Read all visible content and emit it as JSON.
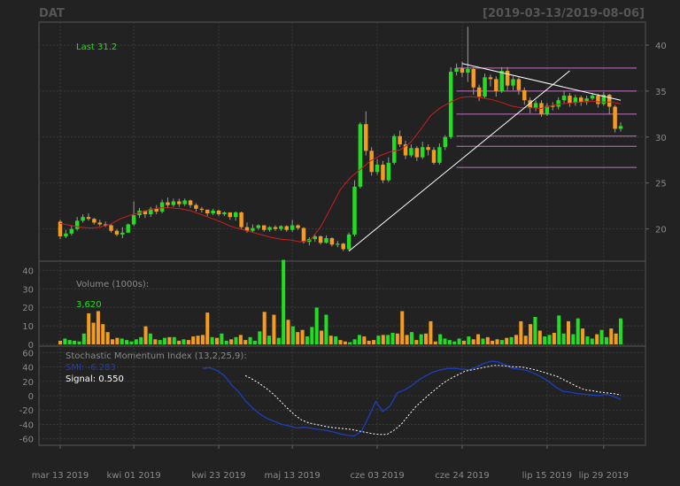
{
  "header": {
    "symbol": "DAT",
    "range": "[2019-03-13/2019-08-06]"
  },
  "labels": {
    "last": "Last 31.2",
    "volume_title": "Volume (1000s):",
    "volume_value": "3,620",
    "smi_title": "Stochastic Momentum Index (13,2,25,9):",
    "smi_value": "SMI: -6.283",
    "signal_value": "Signal: 0.550"
  },
  "colors": {
    "background": "#222222",
    "up": "#22dd22",
    "down": "#f39c1f",
    "label_green": "#22dd22",
    "smi_line": "#1a3fbf",
    "signal_line": "#ffffff",
    "ma_line": "#cc1f1f",
    "trend_line": "#ffffff",
    "support_lines": "#c670c6",
    "grid": "#3a3a3a",
    "axis_text": "#8a8a8a"
  },
  "chart_data": {
    "type": "candlestick",
    "title": "DAT",
    "subtitle": "[2019-03-13/2019-08-06]",
    "x_tick_labels": [
      "mar 13 2019",
      "kwi 01 2019",
      "kwi 23 2019",
      "maj 13 2019",
      "cze 03 2019",
      "cze 24 2019",
      "lip 15 2019",
      "lip 29 2019"
    ],
    "x_tick_positions": [
      0,
      13,
      28,
      41,
      56,
      71,
      86,
      96
    ],
    "price_axis": {
      "ticks": [
        20,
        25,
        30,
        35,
        40
      ],
      "ylim": [
        16.5,
        42.5
      ]
    },
    "volume_axis": {
      "ticks": [
        0,
        10,
        20,
        30,
        40
      ],
      "ylim": [
        0,
        44
      ]
    },
    "smi_axis": {
      "ticks": [
        -60,
        -40,
        -20,
        0,
        20,
        40,
        60
      ],
      "ylim": [
        -69,
        69
      ]
    },
    "candles": [
      [
        20.8,
        20.6,
        19.2,
        21.0,
        18.9
      ],
      [
        19.2,
        19.7,
        19.5,
        19.9,
        19.0
      ],
      [
        19.5,
        20.1,
        20.0,
        20.4,
        19.3
      ],
      [
        20.0,
        21.2,
        20.9,
        21.3,
        19.8
      ],
      [
        20.9,
        21.0,
        21.3,
        21.6,
        20.7
      ],
      [
        21.3,
        21.5,
        21.1,
        21.7,
        20.9
      ],
      [
        21.1,
        21.0,
        20.7,
        21.2,
        20.5
      ],
      [
        20.7,
        20.8,
        20.5,
        21.0,
        20.3
      ],
      [
        20.5,
        20.6,
        20.4,
        20.8,
        20.2
      ],
      [
        20.4,
        20.3,
        19.8,
        20.5,
        19.6
      ],
      [
        19.8,
        19.7,
        19.4,
        20.0,
        19.2
      ],
      [
        19.4,
        20.0,
        19.6,
        20.2,
        19.0
      ],
      [
        19.6,
        20.2,
        20.5,
        20.6,
        19.8
      ],
      [
        20.5,
        22.0,
        21.5,
        23.0,
        20.3
      ],
      [
        21.5,
        21.8,
        22.0,
        22.3,
        21.2
      ],
      [
        22.0,
        21.5,
        21.6,
        22.0,
        21.2
      ],
      [
        21.6,
        21.8,
        22.2,
        22.4,
        21.3
      ],
      [
        22.2,
        22.4,
        21.9,
        22.6,
        21.6
      ],
      [
        21.9,
        22.7,
        22.9,
        23.2,
        21.7
      ],
      [
        22.9,
        23.0,
        22.6,
        23.4,
        22.3
      ],
      [
        22.6,
        22.8,
        23.0,
        23.3,
        22.4
      ],
      [
        23.0,
        23.1,
        22.7,
        23.3,
        22.4
      ],
      [
        22.7,
        22.9,
        23.1,
        23.3,
        22.5
      ],
      [
        23.1,
        23.0,
        22.6,
        23.2,
        22.3
      ],
      [
        22.6,
        22.5,
        22.2,
        22.8,
        21.9
      ],
      [
        22.2,
        22.3,
        22.1,
        22.4,
        21.8
      ],
      [
        22.1,
        21.9,
        21.7,
        22.1,
        21.4
      ],
      [
        21.7,
        21.8,
        22.0,
        22.2,
        21.5
      ],
      [
        22.0,
        21.9,
        21.6,
        22.1,
        21.4
      ],
      [
        21.6,
        21.7,
        21.8,
        21.9,
        21.4
      ],
      [
        21.8,
        21.6,
        21.3,
        21.8,
        21.0
      ],
      [
        21.3,
        21.5,
        21.8,
        21.9,
        20.9
      ],
      [
        21.8,
        21.5,
        20.2,
        21.9,
        20.0
      ],
      [
        20.2,
        20.5,
        19.8,
        20.7,
        19.6
      ],
      [
        19.8,
        20.3,
        20.1,
        20.5,
        19.6
      ],
      [
        20.1,
        20.2,
        20.4,
        20.5,
        19.9
      ],
      [
        20.4,
        20.2,
        19.9,
        20.4,
        19.7
      ],
      [
        19.9,
        20.1,
        20.2,
        20.3,
        19.7
      ],
      [
        20.2,
        20.3,
        20.0,
        20.4,
        19.8
      ],
      [
        20.0,
        20.1,
        20.3,
        20.4,
        19.8
      ],
      [
        20.3,
        20.2,
        19.9,
        20.4,
        19.7
      ],
      [
        19.9,
        20.3,
        20.4,
        21.0,
        19.7
      ],
      [
        20.4,
        20.2,
        20.1,
        20.5,
        19.9
      ],
      [
        20.1,
        19.9,
        18.6,
        20.2,
        18.4
      ],
      [
        18.6,
        18.5,
        18.9,
        19.1,
        18.2
      ],
      [
        18.9,
        19.1,
        19.2,
        19.4,
        18.6
      ],
      [
        19.2,
        19.0,
        18.5,
        19.3,
        18.3
      ],
      [
        18.5,
        18.7,
        19.0,
        19.3,
        18.4
      ],
      [
        19.0,
        18.9,
        18.3,
        19.1,
        18.1
      ],
      [
        18.3,
        18.5,
        18.4,
        18.7,
        18.0
      ],
      [
        18.4,
        18.2,
        17.8,
        18.5,
        17.6
      ],
      [
        17.8,
        18.6,
        19.4,
        19.6,
        17.6
      ],
      [
        19.4,
        23.0,
        24.6,
        25.3,
        19.2
      ],
      [
        24.6,
        30.0,
        31.4,
        31.6,
        24.4
      ],
      [
        31.4,
        31.0,
        28.5,
        32.8,
        28.0
      ],
      [
        28.5,
        27.5,
        26.2,
        28.9,
        25.8
      ],
      [
        26.2,
        27.0,
        27.0,
        27.6,
        25.9
      ],
      [
        27.0,
        26.2,
        25.3,
        27.4,
        25.0
      ],
      [
        25.3,
        26.0,
        27.2,
        27.8,
        25.1
      ],
      [
        27.2,
        28.5,
        30.1,
        30.3,
        27.0
      ],
      [
        30.1,
        29.8,
        29.2,
        30.7,
        28.9
      ],
      [
        29.2,
        28.6,
        28.0,
        29.6,
        27.6
      ],
      [
        28.0,
        28.5,
        28.8,
        29.2,
        27.8
      ],
      [
        28.8,
        28.4,
        27.8,
        29.0,
        27.4
      ],
      [
        27.8,
        28.3,
        28.9,
        29.5,
        27.6
      ],
      [
        28.9,
        28.7,
        28.6,
        29.2,
        28.0
      ],
      [
        28.6,
        28.0,
        27.2,
        28.9,
        27.0
      ],
      [
        27.2,
        28.3,
        28.9,
        29.3,
        27.0
      ],
      [
        28.9,
        29.5,
        30.0,
        30.2,
        28.6
      ],
      [
        30.0,
        34.0,
        37.1,
        37.6,
        29.8
      ],
      [
        37.1,
        37.3,
        37.5,
        38.0,
        36.7
      ],
      [
        37.5,
        37.2,
        37.0,
        38.2,
        36.5
      ],
      [
        37.0,
        38.5,
        37.4,
        42.0,
        36.0
      ],
      [
        37.4,
        36.7,
        35.4,
        37.6,
        34.6
      ],
      [
        35.4,
        35.0,
        34.4,
        35.7,
        33.9
      ],
      [
        34.4,
        35.6,
        36.5,
        36.9,
        34.2
      ],
      [
        36.5,
        36.4,
        36.3,
        36.8,
        35.5
      ],
      [
        36.3,
        35.3,
        35.0,
        36.6,
        34.4
      ],
      [
        35.0,
        36.0,
        37.2,
        37.6,
        34.8
      ],
      [
        37.2,
        36.8,
        35.6,
        37.6,
        35.1
      ],
      [
        35.6,
        36.0,
        36.3,
        36.6,
        35.1
      ],
      [
        36.3,
        35.8,
        35.1,
        36.5,
        34.6
      ],
      [
        35.1,
        34.6,
        34.0,
        35.4,
        33.5
      ],
      [
        34.0,
        33.8,
        33.2,
        34.3,
        32.6
      ],
      [
        33.2,
        33.5,
        33.7,
        34.0,
        32.8
      ],
      [
        33.7,
        33.2,
        32.5,
        34.0,
        32.2
      ],
      [
        32.5,
        33.0,
        33.4,
        33.7,
        32.3
      ],
      [
        33.4,
        33.5,
        33.3,
        33.8,
        32.9
      ],
      [
        33.3,
        33.6,
        34.0,
        34.3,
        33.0
      ],
      [
        34.0,
        34.2,
        34.5,
        35.0,
        33.7
      ],
      [
        34.5,
        34.0,
        33.7,
        34.8,
        33.3
      ],
      [
        33.7,
        33.9,
        34.3,
        34.6,
        33.4
      ],
      [
        34.3,
        34.1,
        33.8,
        34.5,
        33.4
      ],
      [
        33.8,
        34.0,
        34.2,
        34.5,
        33.5
      ],
      [
        34.2,
        34.3,
        34.5,
        34.8,
        34.0
      ],
      [
        34.5,
        34.0,
        33.6,
        34.7,
        33.2
      ],
      [
        33.6,
        34.1,
        34.6,
        34.9,
        33.4
      ],
      [
        34.6,
        34.0,
        33.3,
        34.7,
        32.5
      ],
      [
        33.3,
        32.0,
        30.9,
        33.5,
        30.5
      ],
      [
        30.9,
        31.2,
        31.2,
        31.6,
        30.6
      ]
    ],
    "volume": [
      0.5,
      0.8,
      0.6,
      0.5,
      0.4,
      1.5,
      4.3,
      3.0,
      4.6,
      2.8,
      1.7,
      0.7,
      0.9,
      0.8,
      0.6,
      0.4,
      0.7,
      1.0,
      2.5,
      1.5,
      0.7,
      0.6,
      0.9,
      1.0,
      1.0,
      0.5,
      0.7,
      0.6,
      1.1,
      1.2,
      1.3,
      4.4,
      1.0,
      0.9,
      1.5,
      0.5,
      0.7,
      1.0,
      1.3,
      0.6,
      1.0,
      0.5,
      1.8,
      4.5,
      1.2,
      4.1,
      0.9,
      11.7,
      3.4,
      2.5,
      1.7,
      2.0,
      1.1,
      2.4,
      5.1,
      1.9,
      4.1,
      1.2,
      1.1,
      0.6,
      0.4,
      0.3,
      0.7,
      1.3,
      1.1,
      0.5,
      0.6,
      1.2,
      1.3,
      1.3,
      1.6,
      1.5,
      4.6,
      1.3,
      1.7,
      0.6,
      1.4,
      1.5,
      3.2,
      0.4,
      1.4,
      0.8,
      0.6,
      0.4,
      0.8,
      0.5,
      1.1,
      0.7,
      1.4,
      0.8,
      1.0,
      0.5,
      0.7,
      0.6,
      0.9,
      1.0,
      1.3,
      3.2,
      1.2,
      2.8,
      3.8,
      1.9,
      1.1,
      1.3,
      1.6,
      4.0,
      1.5,
      3.2,
      1.4,
      3.6,
      2.2,
      1.1,
      0.8,
      1.4,
      2.0,
      1.0,
      2.2,
      1.5,
      3.6
    ],
    "smi": [
      38,
      39,
      35,
      28,
      15,
      5,
      -8,
      -18,
      -26,
      -32,
      -36,
      -40,
      -42,
      -45,
      -44,
      -45,
      -47,
      -48,
      -50,
      -53,
      -55,
      -56,
      -50,
      -30,
      -8,
      -22,
      -14,
      4,
      8,
      14,
      22,
      28,
      33,
      36,
      38,
      38,
      37,
      36,
      40,
      45,
      48,
      47,
      43,
      38,
      37,
      35,
      31,
      26,
      20,
      12,
      6,
      5,
      3,
      2,
      1,
      0,
      2,
      -1,
      -5
    ],
    "signal": [
      28,
      23,
      17,
      10,
      2,
      -8,
      -18,
      -27,
      -34,
      -38,
      -40,
      -42,
      -44,
      -45,
      -46,
      -47,
      -49,
      -51,
      -53,
      -54,
      -54,
      -48,
      -40,
      -28,
      -16,
      -7,
      2,
      10,
      18,
      24,
      29,
      34,
      36,
      38,
      40,
      42,
      42,
      41,
      40,
      40,
      38,
      36,
      33,
      30,
      27,
      22,
      17,
      12,
      8,
      7,
      5,
      4,
      3,
      1
    ],
    "ma": [
      20.6,
      20.4,
      20.2,
      20.1,
      20.2,
      20.5,
      21.1,
      21.5,
      21.8,
      22.1,
      22.3,
      22.3,
      22.2,
      22.0,
      21.6,
      21.2,
      20.8,
      20.3,
      20.0,
      19.7,
      19.4,
      19.1,
      18.9,
      18.8,
      18.6,
      18.8,
      20.2,
      22.2,
      24.3,
      25.6,
      26.5,
      27.4,
      28.0,
      28.4,
      28.6,
      29.4,
      30.8,
      32.3,
      33.2,
      33.8,
      34.3,
      34.4,
      34.3,
      34.1,
      33.8,
      33.4,
      33.2,
      33.2,
      33.1,
      33.4,
      33.6,
      33.7,
      33.8,
      33.9,
      33.8,
      33.8,
      33.6
    ],
    "ma_label": "",
    "trend_lines": [
      {
        "from": [
          51,
          17.6
        ],
        "to": [
          90,
          37.2
        ]
      },
      {
        "from": [
          71,
          38.0
        ],
        "to": [
          99,
          34.0
        ]
      }
    ],
    "support_levels": [
      37.5,
      35.0,
      32.5,
      30.1,
      29.0,
      26.7
    ],
    "last_price": 31.2,
    "volume_last": 3620,
    "smi_last": -6.283,
    "signal_last": 0.55
  }
}
